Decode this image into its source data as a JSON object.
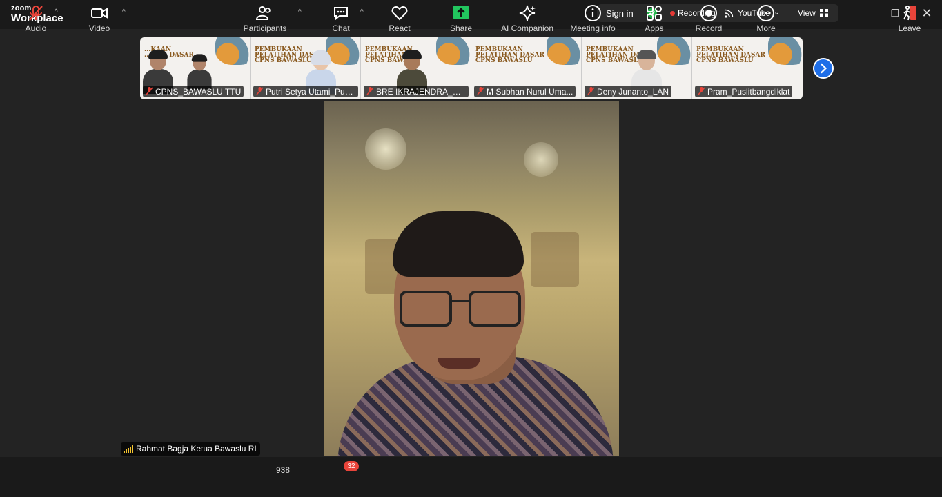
{
  "app": {
    "brand_small": "zoom",
    "brand_large": "Workplace"
  },
  "titlebar": {
    "signin": "Sign in",
    "recording": "Recording",
    "stream": "YouTube",
    "view": "View"
  },
  "participants_strip": [
    {
      "name": "CPNS_BAWASLU TTU",
      "banner": "...KAAN",
      "banner_line2": "...HAN DASAR",
      "banner_line3": "...SLU"
    },
    {
      "name": "Putri Setya Utami_Puslitb...",
      "banner": "PEMBUKAAN",
      "banner_line2": "PELATIHAN DASAR",
      "banner_line3": "CPNS BAWASLU"
    },
    {
      "name": "BRE IKRAJENDRA_PU...",
      "banner": "PEMBUKAAN",
      "banner_line2": "PELATIHAN",
      "banner_line3": "CPNS BAWAS"
    },
    {
      "name": "M Subhan Nurul Uma...",
      "banner": "PEMBUKAAN",
      "banner_line2": "PELATIHAN DASAR",
      "banner_line3": "CPNS BAWASLU"
    },
    {
      "name": "Deny Junanto_LAN",
      "banner": "PEMBUKAAN",
      "banner_line2": "PELATIHAN DASAR",
      "banner_line3": "CPNS BAWASLU"
    },
    {
      "name": "Pram_Puslitbangdiklat",
      "banner": "PEMBUKAAN",
      "banner_line2": "PELATIHAN DASAR",
      "banner_line3": "CPNS BAWASLU"
    }
  ],
  "active_speaker": {
    "name": "Rahmat Bagja Ketua Bawaslu RI"
  },
  "toolbar": {
    "audio": "Audio",
    "video": "Video",
    "participants": "Participants",
    "participants_count": "938",
    "chat": "Chat",
    "chat_badge": "32",
    "react": "React",
    "share": "Share",
    "ai_companion": "AI Companion",
    "meeting_info": "Meeting info",
    "apps": "Apps",
    "record": "Record",
    "more": "More",
    "leave": "Leave"
  },
  "colors": {
    "accent": "#1e6ee8",
    "share": "#22c55e",
    "recording": "#e53935",
    "leave": "#e8443a"
  }
}
